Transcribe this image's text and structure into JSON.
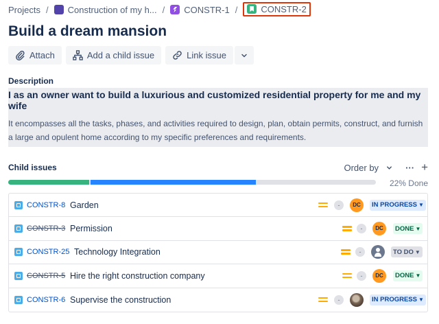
{
  "breadcrumb": {
    "items": [
      {
        "label": "Projects"
      },
      {
        "label": "Construction of my h..."
      },
      {
        "label": "CONSTR-1"
      },
      {
        "label": "CONSTR-2"
      }
    ],
    "separator": "/"
  },
  "issue": {
    "title": "Build a dream mansion"
  },
  "actions": {
    "attach": "Attach",
    "add_child": "Add a child issue",
    "link_issue": "Link issue"
  },
  "description": {
    "label": "Description",
    "headline": "I as an owner want to build a luxurious and customized residential property for me and my wife",
    "body": "It encompasses all the tasks, phases, and activities required to design, plan, obtain permits, construct, and furnish a large and opulent home according to my specific preferences and requirements."
  },
  "child_issues": {
    "title": "Child issues",
    "order_by": "Order by",
    "more": "···",
    "add": "+",
    "progress_text": "22% Done",
    "progress": {
      "done": 0.22,
      "in_progress": 0.45
    },
    "colors": {
      "done": "#36b37e",
      "in_progress": "#2684ff"
    },
    "items": [
      {
        "key": "CONSTR-8",
        "summary": "Garden",
        "done": false,
        "estimate": "-",
        "assignee": "DC",
        "status": "IN PROGRESS"
      },
      {
        "key": "CONSTR-3",
        "summary": "Permission",
        "done": true,
        "estimate": "-",
        "assignee": "DC",
        "status": "DONE"
      },
      {
        "key": "CONSTR-25",
        "summary": "Technology Integration",
        "done": false,
        "estimate": "-",
        "assignee": "",
        "status": "TO DO"
      },
      {
        "key": "CONSTR-5",
        "summary": "Hire the right construction company",
        "done": true,
        "estimate": "-",
        "assignee": "DC",
        "status": "DONE"
      },
      {
        "key": "CONSTR-6",
        "summary": "Supervise the construction",
        "done": false,
        "estimate": "-",
        "assignee": "",
        "status": "IN PROGRESS"
      }
    ]
  }
}
